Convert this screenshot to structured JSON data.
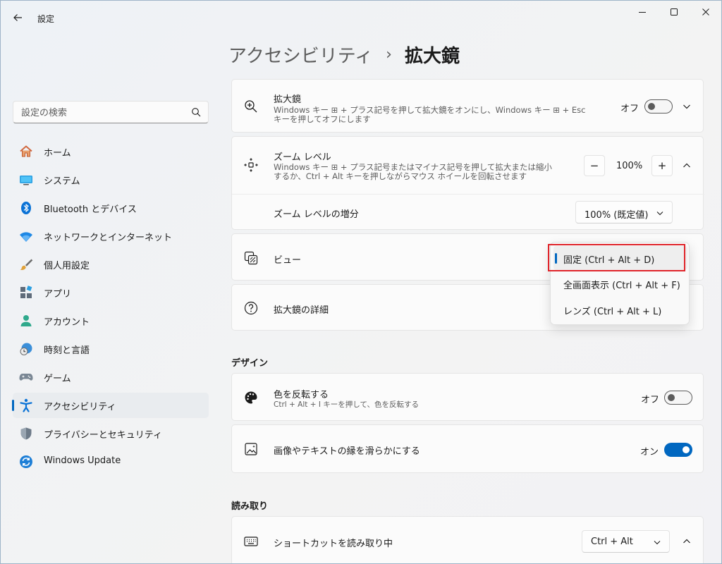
{
  "window": {
    "title": "設定",
    "controls": [
      "minimize-icon",
      "maximize-icon",
      "close-icon"
    ]
  },
  "sidebar": {
    "search_placeholder": "設定の検索",
    "items": [
      {
        "label": "ホーム",
        "icon": "home-icon"
      },
      {
        "label": "システム",
        "icon": "system-icon"
      },
      {
        "label": "Bluetooth とデバイス",
        "icon": "bluetooth-icon"
      },
      {
        "label": "ネットワークとインターネット",
        "icon": "wifi-icon"
      },
      {
        "label": "個人用設定",
        "icon": "brush-icon"
      },
      {
        "label": "アプリ",
        "icon": "apps-icon"
      },
      {
        "label": "アカウント",
        "icon": "account-icon"
      },
      {
        "label": "時刻と言語",
        "icon": "time-language-icon"
      },
      {
        "label": "ゲーム",
        "icon": "gamepad-icon"
      },
      {
        "label": "アクセシビリティ",
        "icon": "accessibility-icon",
        "active": true
      },
      {
        "label": "プライバシーとセキュリティ",
        "icon": "shield-icon"
      },
      {
        "label": "Windows Update",
        "icon": "update-icon"
      }
    ]
  },
  "breadcrumb": {
    "parent": "アクセシビリティ",
    "separator": "›",
    "current": "拡大鏡"
  },
  "magnifier": {
    "title": "拡大鏡",
    "desc_line1": "Windows キー ⊞ + プラス記号を押して拡大鏡をオンにし、Windows キー ⊞ + Esc",
    "desc_line2": "キーを押してオフにします",
    "toggle_label": "オフ",
    "toggle_state": false
  },
  "zoom_level": {
    "title": "ズーム レベル",
    "desc_line1": "Windows キー ⊞ + プラス記号またはマイナス記号を押して拡大または縮小",
    "desc_line2": "するか、Ctrl + Alt キーを押しながらマウス ホイールを回転させます",
    "decrease": "−",
    "value": "100%",
    "increase": "+"
  },
  "zoom_increment": {
    "title": "ズーム レベルの増分",
    "selected": "100% (既定値)"
  },
  "view": {
    "title": "ビュー",
    "options": [
      "固定 (Ctrl + Alt + D)",
      "全画面表示 (Ctrl + Alt + F)",
      "レンズ (Ctrl + Alt + L)"
    ],
    "selected_index": 0
  },
  "magnifier_details": {
    "title": "拡大鏡の詳細"
  },
  "design": {
    "section_title": "デザイン",
    "invert": {
      "title": "色を反転する",
      "desc": "Ctrl + Alt + I キーを押して、色を反転する",
      "toggle_label": "オフ",
      "toggle_state": false
    },
    "smooth": {
      "title": "画像やテキストの縁を滑らかにする",
      "toggle_label": "オン",
      "toggle_state": true
    }
  },
  "reading": {
    "section_title": "読み取り",
    "shortcut": {
      "title": "ショートカットを読み取り中",
      "selected": "Ctrl + Alt"
    }
  },
  "colors": {
    "accent": "#0067c0",
    "highlight": "#e0242a"
  }
}
